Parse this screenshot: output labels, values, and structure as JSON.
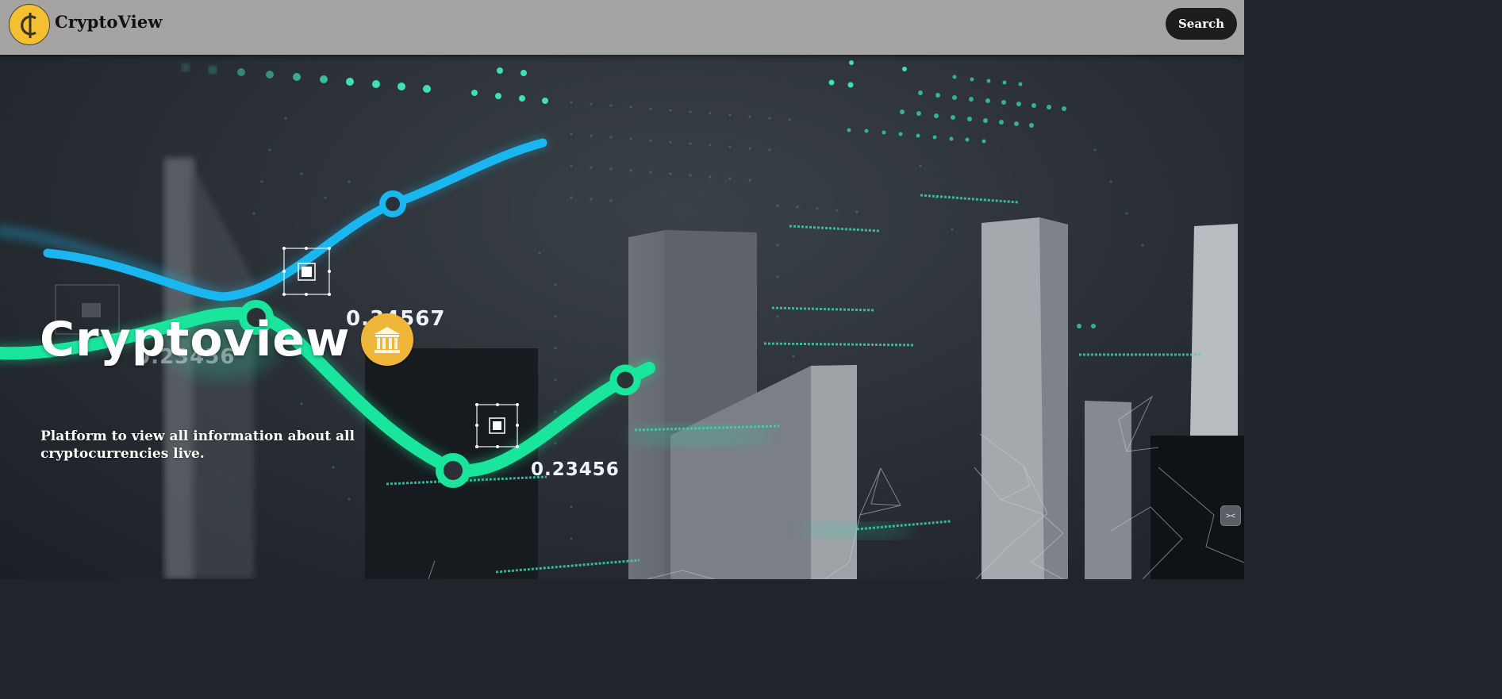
{
  "header": {
    "brand": "CryptoView",
    "search_label": "Search"
  },
  "hero": {
    "title": "Cryptoview",
    "subtitle": "Platform to view all information about all cryptocurrencies live.",
    "chart_labels": [
      "0.34567",
      "0.23456",
      "0.23456"
    ]
  },
  "icons": {
    "logo": "cedi-coin-icon",
    "title_badge": "bank-icon",
    "widget": "collapse-icon"
  },
  "colors": {
    "nav_bg": "#a5a4a2",
    "logo_yellow": "#f5c02f",
    "button_bg": "#1d1d1d",
    "line_green": "#19e59c",
    "line_blue": "#1ab6f0"
  }
}
